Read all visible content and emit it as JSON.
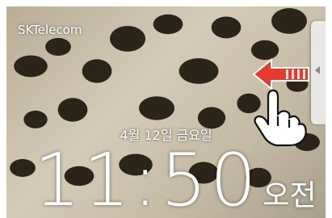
{
  "status_bar": {
    "carrier": "SKTelecom"
  },
  "lockscreen": {
    "date": "4월 12일 금요일",
    "time": "11:50",
    "ampm": "오전"
  },
  "icons": {
    "side_tab_chevron": "chevron-left-icon",
    "swipe_arrow": "arrow-left-icon",
    "hand": "hand-pointer-icon"
  },
  "colors": {
    "arrow": "#e8392f",
    "text": "#ffffff"
  }
}
